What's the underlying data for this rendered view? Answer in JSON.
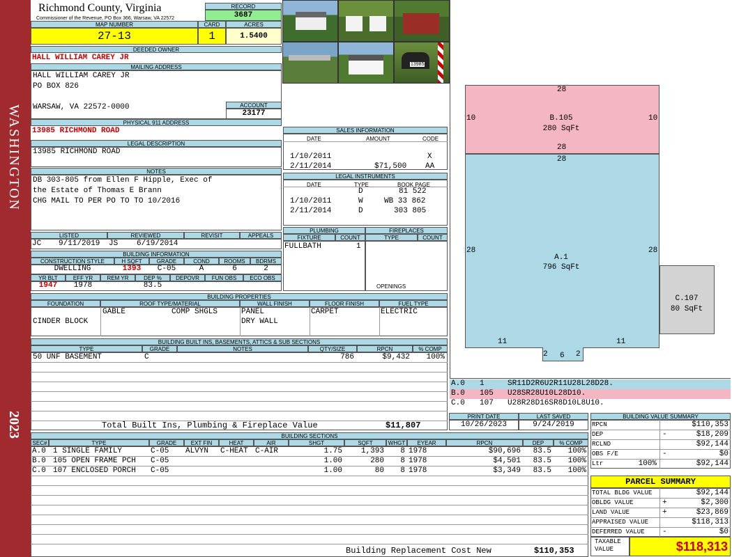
{
  "sidebar": {
    "district": "WASHINGTON",
    "year": "2023"
  },
  "header": {
    "county": "Richmond County, Virginia",
    "commissioner": "Commissioner of the Revenue, PO Box 366, Warsaw, VA 22572",
    "record_label": "RECORD",
    "record": "3687",
    "map_label": "MAP NUMBER",
    "map": "27-13",
    "card_label": "CARD",
    "card": "1",
    "acres_label": "ACRES",
    "acres": "1.5400"
  },
  "owner": {
    "label": "DEEDED OWNER",
    "name": "HALL WILLIAM CAREY JR",
    "mail_label": "MAILING ADDRESS",
    "mail1": "HALL WILLIAM CAREY JR",
    "mail2": "PO BOX 826",
    "mail3": "WARSAW, VA 22572-0000",
    "account_label": "ACCOUNT",
    "account": "23177",
    "phys_label": "PHYSICAL 911 ADDRESS",
    "phys": "13985 RICHMOND ROAD",
    "legal_label": "LEGAL DESCRIPTION",
    "legal": "13985 RICHMOND ROAD",
    "notes_label": "NOTES",
    "notes": [
      "DB 303-805 from Ellen F Hipple, Exec of",
      "the Estate of Thomas E Brann",
      "CHG MAIL TO PER PO TO TO 10/2016"
    ]
  },
  "photos": {
    "mailbox_number": "13985"
  },
  "review": {
    "listed_label": "LISTED",
    "reviewed_label": "REVIEWED",
    "revisit_label": "REVISIT",
    "appeals_label": "APPEALS",
    "listed_by": "JC",
    "listed_date": "9/11/2019",
    "reviewed_by": "JS",
    "reviewed_date": "6/19/2014"
  },
  "building_info": {
    "label": "BUILDING INFORMATION",
    "h": [
      "CONSTRUCTION STYLE",
      "H SQFT",
      "GRADE",
      "COND",
      "ROOMS",
      "BDRMS"
    ],
    "v": [
      "DWELLING",
      "1393",
      "C-05",
      "A",
      "6",
      "2"
    ],
    "h2": [
      "YR BLT",
      "EFF YR",
      "REM YR",
      "DEP %",
      "DEPOVR",
      "FUN OBS",
      "ECO OBS"
    ],
    "v2": [
      "1947",
      "1978",
      "",
      "83.5",
      "",
      "",
      ""
    ]
  },
  "sales": {
    "label": "SALES INFORMATION",
    "h": [
      "DATE",
      "AMOUNT",
      "CODE"
    ],
    "rows": [
      [
        "1/10/2011",
        "",
        "X"
      ],
      [
        "2/11/2014",
        "$71,500",
        "AA"
      ]
    ]
  },
  "legal_inst": {
    "label": "LEGAL INSTRUMENTS",
    "h": [
      "DATE",
      "TYPE",
      "BOOK PAGE"
    ],
    "rows": [
      [
        "",
        "D",
        "81 522"
      ],
      [
        "1/10/2011",
        "W",
        "WB 33 862"
      ],
      [
        "2/11/2014",
        "D",
        "303 805"
      ]
    ]
  },
  "plumbing": {
    "label": "PLUMBING",
    "h": [
      "FIXTURE",
      "COUNT"
    ],
    "rows": [
      [
        "FULLBATH",
        "1"
      ]
    ]
  },
  "fireplaces": {
    "label": "FIREPLACES",
    "h": [
      "TYPE",
      "COUNT"
    ],
    "openings": "OPENINGS"
  },
  "props": {
    "label": "BUILDING PROPERTIES",
    "h": [
      "FOUNDATION",
      "ROOF TYPE/MATERIAL",
      "WALL FINISH",
      "FLOOR FINISH",
      "FUEL TYPE"
    ],
    "foundation": "CINDER BLOCK",
    "roof1": "GABLE",
    "roof2": "COMP SHGLS",
    "wall1": "PANEL",
    "wall2": "DRY WALL",
    "floor": "CARPET",
    "fuel": "ELECTRIC"
  },
  "builtins": {
    "label": "BUILDING BUILT INS, BASEMENTS, ATTICS & SUB SECTIONS",
    "h": [
      "TYPE",
      "GRADE",
      "NOTES",
      "QTY/SIZE",
      "RPCN",
      "% COMP"
    ],
    "rows": [
      [
        "50 UNF BASEMENT",
        "C",
        "",
        "786",
        "$9,432",
        "100%"
      ]
    ],
    "total_label": "Total Built Ins, Plumbing & Fireplace Value",
    "total": "$11,807"
  },
  "dates": {
    "print_label": "PRINT DATE",
    "saved_label": "LAST SAVED",
    "print": "10/26/2023",
    "saved": "9/24/2019"
  },
  "sections": {
    "label": "BUILDING SECTIONS",
    "h": [
      "SEC#",
      "TYPE",
      "GRADE",
      "EXT FIN",
      "HEAT",
      "AIR",
      "SHGT",
      "SQFT",
      "WHGT",
      "EYEAR",
      "RPCN",
      "DEP",
      "% COMP"
    ],
    "rows": [
      [
        "A.0",
        "1 SINGLE FAMILY",
        "C-05",
        "ALVYN",
        "C-HEAT",
        "C-AIR",
        "1.75",
        "1,393",
        "8",
        "1978",
        "$90,696",
        "83.5",
        "100%"
      ],
      [
        "B.0",
        "105 OPEN FRAME PCH",
        "C-05",
        "",
        "",
        "",
        "1.00",
        "280",
        "8",
        "1978",
        "$4,501",
        "83.5",
        "100%"
      ],
      [
        "C.0",
        "107 ENCLOSED PORCH",
        "C-05",
        "",
        "",
        "",
        "1.00",
        "80",
        "8",
        "1978",
        "$3,349",
        "83.5",
        "100%"
      ]
    ],
    "brcn_label": "Building Replacement Cost New",
    "brcn": "$110,353"
  },
  "sketch": {
    "b_label": "B.105",
    "b_area": "280 SqFt",
    "a_label": "A.1",
    "a_area": "796 SqFt",
    "c_label": "C.107",
    "c_area": "80 SqFt",
    "dims": {
      "b_top": "28",
      "b_left": "10",
      "b_right": "10",
      "b_bottom": "28",
      "a_top": "28",
      "a_left": "28",
      "a_right": "28",
      "a_bl": "11",
      "a_br": "11",
      "n1": "2",
      "n2": "6",
      "n3": "2"
    },
    "legend": [
      [
        "A.0",
        "1",
        "SR11D2R6U2R11U28L28D28."
      ],
      [
        "B.0",
        "105",
        "U28SR28U10L28D10."
      ],
      [
        "C.0",
        "107",
        "U28R28D16SR8D10L8U10."
      ]
    ]
  },
  "summary": {
    "label": "BUILDING VALUE SUMMARY",
    "rows": [
      [
        "RPCN",
        "",
        "$110,353"
      ],
      [
        "DEP",
        "-",
        "$18,209"
      ],
      [
        "RCLND",
        "",
        "$92,144"
      ],
      [
        "OBS F/E",
        "-",
        "$0"
      ],
      [
        "Ltr",
        "100%",
        "$92,144"
      ]
    ]
  },
  "parcel": {
    "label": "PARCEL SUMMARY",
    "rows": [
      [
        "TOTAL BLDG VALUE",
        "",
        "$92,144"
      ],
      [
        "OBLDG VALUE",
        "+",
        "$2,300"
      ],
      [
        "LAND VALUE",
        "+",
        "$23,869"
      ],
      [
        "APPRAISED VALUE",
        "",
        "$118,313"
      ],
      [
        "DEFERRED VALUE",
        "-",
        "$0"
      ]
    ],
    "taxable_label1": "TAXABLE",
    "taxable_label2": "VALUE",
    "taxable": "$118,313"
  },
  "colors": {
    "sidebar": "#a12a2f",
    "header_blue": "#add8e6",
    "yellow": "#ffff00",
    "record_green": "#90ee90",
    "porch_pink": "#f4b6c2",
    "main_blue": "#add8e6",
    "enclosed_gray": "#d3d3d3"
  }
}
